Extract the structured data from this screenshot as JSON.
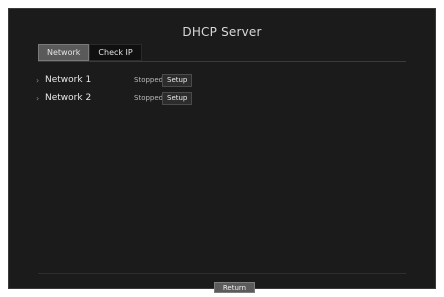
{
  "window": {
    "title": "DHCP Server"
  },
  "tabs": [
    {
      "label": "Network",
      "active": true
    },
    {
      "label": "Check IP",
      "active": false
    }
  ],
  "networks": [
    {
      "name": "Network 1",
      "status": "Stopped",
      "action": "Setup"
    },
    {
      "name": "Network 2",
      "status": "Stopped",
      "action": "Setup"
    }
  ],
  "footer": {
    "return_label": "Return"
  },
  "colors": {
    "panel_bg": "#1b1b1b",
    "active_tab_bg": "#5a5a5a",
    "text": "#e8e8e8"
  },
  "icons": {
    "row_chevron": "chevron-right-icon"
  }
}
